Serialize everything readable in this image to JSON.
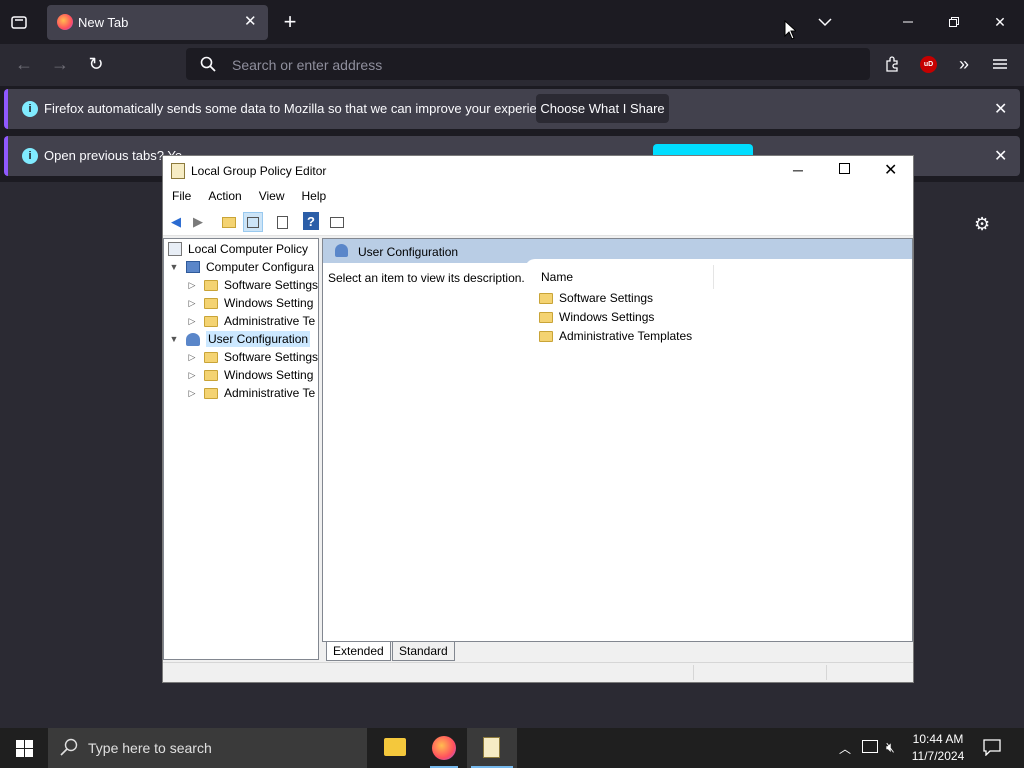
{
  "browser": {
    "tab_title": "New Tab",
    "search_placeholder": "Search or enter address",
    "notifications": [
      {
        "text": "Firefox automatically sends some data to Mozilla so that we can improve your experience.",
        "button": "Choose What I Share"
      },
      {
        "text": "Open previous tabs? Yo"
      }
    ],
    "accent": "#9059ff"
  },
  "gpedit": {
    "title": "Local Group Policy Editor",
    "menu": [
      "File",
      "Action",
      "View",
      "Help"
    ],
    "tree": {
      "root": "Local Computer Policy",
      "computer": "Computer Configura",
      "computer_children": [
        "Software Settings",
        "Windows Setting",
        "Administrative Te"
      ],
      "user": "User Configuration",
      "user_children": [
        "Software Settings",
        "Windows Setting",
        "Administrative Te"
      ]
    },
    "pane": {
      "header": "User Configuration",
      "description": "Select an item to view its description.",
      "column_name": "Name",
      "items": [
        "Software Settings",
        "Windows Settings",
        "Administrative Templates"
      ]
    },
    "bottom_tabs": [
      "Extended",
      "Standard"
    ]
  },
  "taskbar": {
    "search_placeholder": "Type here to search",
    "time": "10:44 AM",
    "date": "11/7/2024"
  }
}
